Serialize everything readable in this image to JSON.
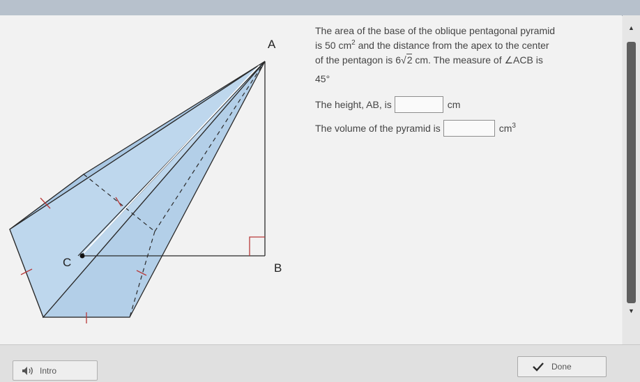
{
  "question": {
    "line1": "The area of the base of the oblique pentagonal pyramid",
    "line2_prefix": "is 50 cm",
    "line2_sup": "2",
    "line2_suffix": " and the distance from the apex to the center",
    "line3_prefix": "of the pentagon is 6",
    "line3_sqrt": "2",
    "line3_suffix": " cm. The measure of ∠ACB is",
    "line4": "45°",
    "height_label": "The height, AB, is",
    "height_unit": "cm",
    "volume_label": "The volume of the pyramid is",
    "volume_unit": "cm",
    "volume_unit_sup": "3"
  },
  "figure": {
    "label_a": "A",
    "label_b": "B",
    "label_c": "C",
    "fill_color": "#b9d3ea",
    "stroke_color": "#2a2a2a",
    "tick_color": "#b83a3a"
  },
  "scrollbar": {
    "up_glyph": "▲",
    "down_glyph": "▼"
  },
  "footer": {
    "intro_label": "Intro",
    "done_label": "Done"
  }
}
